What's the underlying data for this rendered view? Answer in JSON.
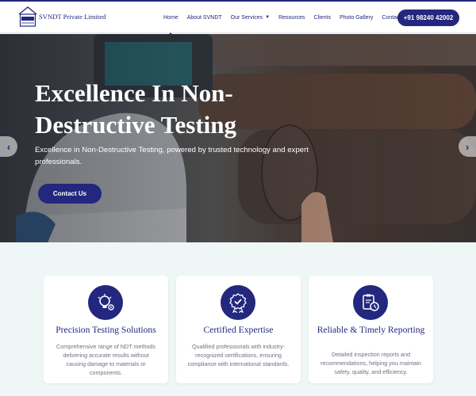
{
  "brand": {
    "name": "SVNDT Private Limited",
    "logo_text": "SVNDT"
  },
  "nav": {
    "items": [
      {
        "label": "Home",
        "active": true
      },
      {
        "label": "About SVNDT"
      },
      {
        "label": "Our Services",
        "has_dropdown": true
      },
      {
        "label": "Resources"
      },
      {
        "label": "Clients"
      },
      {
        "label": "Photo Gallery"
      },
      {
        "label": "Contact Us"
      }
    ],
    "phone_label": "+91 98240 42002"
  },
  "hero": {
    "title": "Excellence In Non-Destructive Testing",
    "subtitle": "Excellence in Non-Destructive Testing, powered by trusted technology and expert professionals.",
    "cta_label": "Contact Us",
    "prev_icon": "chevron-left-icon",
    "next_icon": "chevron-right-icon"
  },
  "features": [
    {
      "icon": "lightbulb-gear-icon",
      "title": "Precision Testing Solutions",
      "text": "Comprehensive range of NDT methods delivering accurate results without causing damage to materials or components."
    },
    {
      "icon": "award-badge-icon",
      "title": "Certified Expertise",
      "text": "Qualified professionals with industry-recognized certifications, ensuring compliance with international standards."
    },
    {
      "icon": "report-clock-icon",
      "title": "Reliable & Timely Reporting",
      "text": "Detailed inspection reports and recommendations, helping you maintain safety, quality, and efficiency."
    }
  ],
  "colors": {
    "primary": "#23287e",
    "background": "#eef6f6",
    "text_muted": "#6c7280"
  }
}
